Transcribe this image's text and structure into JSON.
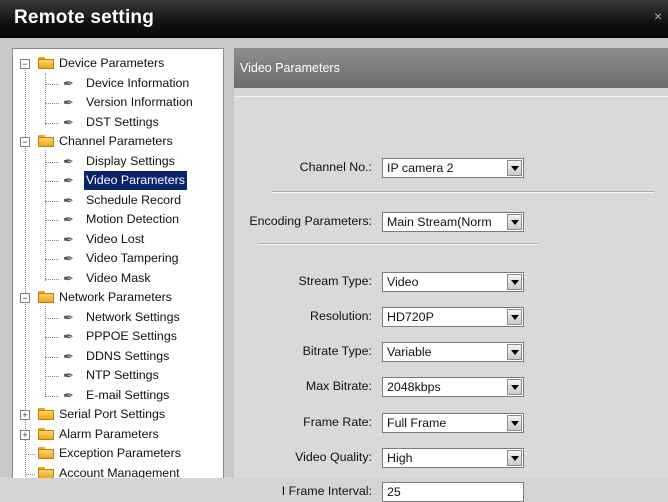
{
  "window": {
    "title": "Remote setting",
    "close_glyph": "×"
  },
  "tree": [
    {
      "label": "Device Parameters",
      "kind": "folder",
      "expander": "−"
    },
    {
      "label": "Device Information",
      "kind": "leaf"
    },
    {
      "label": "Version Information",
      "kind": "leaf"
    },
    {
      "label": "DST Settings",
      "kind": "leaf"
    },
    {
      "label": "Channel Parameters",
      "kind": "folder",
      "expander": "−"
    },
    {
      "label": "Display Settings",
      "kind": "leaf"
    },
    {
      "label": "Video Parameters",
      "kind": "leaf",
      "selected": true
    },
    {
      "label": "Schedule Record",
      "kind": "leaf"
    },
    {
      "label": "Motion Detection",
      "kind": "leaf"
    },
    {
      "label": "Video Lost",
      "kind": "leaf"
    },
    {
      "label": "Video Tampering",
      "kind": "leaf"
    },
    {
      "label": "Video Mask",
      "kind": "leaf"
    },
    {
      "label": "Network Parameters",
      "kind": "folder",
      "expander": "−"
    },
    {
      "label": "Network Settings",
      "kind": "leaf"
    },
    {
      "label": "PPPOE Settings",
      "kind": "leaf"
    },
    {
      "label": "DDNS Settings",
      "kind": "leaf"
    },
    {
      "label": "NTP Settings",
      "kind": "leaf"
    },
    {
      "label": "E-mail Settings",
      "kind": "leaf"
    },
    {
      "label": "Serial Port Settings",
      "kind": "folder",
      "expander": "+"
    },
    {
      "label": "Alarm Parameters",
      "kind": "folder",
      "expander": "+"
    },
    {
      "label": "Exception Parameters",
      "kind": "folder"
    },
    {
      "label": "Account Management",
      "kind": "folder"
    }
  ],
  "panel": {
    "header": "Video Parameters",
    "channel": {
      "label": "Channel No.:",
      "value": "IP camera 2"
    },
    "encoding": {
      "label": "Encoding Parameters:",
      "value": "Main Stream(Norm"
    },
    "fields": {
      "stream_type": {
        "label": "Stream Type:",
        "value": "Video"
      },
      "resolution": {
        "label": "Resolution:",
        "value": "HD720P"
      },
      "bitrate_type": {
        "label": "Bitrate Type:",
        "value": "Variable"
      },
      "max_bitrate": {
        "label": "Max Bitrate:",
        "value": "2048kbps"
      },
      "frame_rate": {
        "label": "Frame Rate:",
        "value": "Full Frame"
      },
      "video_quality": {
        "label": "Video Quality:",
        "value": "High"
      },
      "i_frame_interval": {
        "label": "I Frame Interval:",
        "value": "25"
      }
    }
  },
  "icons": {
    "folder": "folder-icon",
    "leaf": "wrench-icon",
    "dropdown": "chevron-down-icon"
  }
}
